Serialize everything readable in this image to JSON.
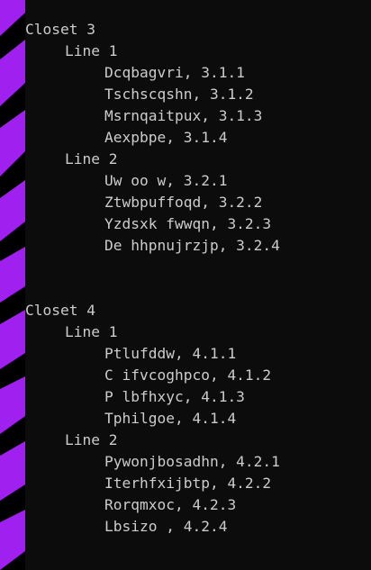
{
  "window": {
    "background_color": "#0c0c0c",
    "text_color": "#cccccc",
    "accent_stripe_colors": [
      "#a020f0",
      "#000000"
    ]
  },
  "terminal": {
    "output_lines": [
      "Closet 3",
      "Line 1",
      "Dcqbagvri, 3.1.1",
      "Tschscqshn, 3.1.2",
      "Msrnqaitpux, 3.1.3",
      "Aexpbpe, 3.1.4",
      "Line 2",
      "Uw oo w, 3.2.1",
      "Ztwbpuffoqd, 3.2.2",
      "Yzdsxk fwwqn, 3.2.3",
      "De hhpnujrzjp, 3.2.4",
      "Closet 4",
      "Line 1",
      "Ptlufddw, 4.1.1",
      "C ifvcoghpco, 4.1.2",
      "P lbfhxyc, 4.1.3",
      "Tphilgoe, 4.1.4",
      "Line 2",
      "Pywonjbosadhn, 4.2.1",
      "Iterhfxijbtp, 4.2.2",
      "Rorqmxoc, 4.2.3",
      "Lbsizo , 4.2.4"
    ]
  }
}
